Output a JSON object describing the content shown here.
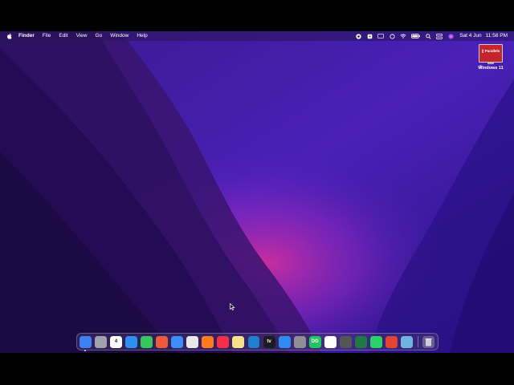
{
  "menubar": {
    "items": [
      "Finder",
      "File",
      "Edit",
      "View",
      "Go",
      "Window",
      "Help"
    ],
    "date": "Sat 4 Jun",
    "time": "11:58 PM",
    "status_icons": [
      "screen-record-icon",
      "notes-icon",
      "keyboard-icon",
      "sync-icon",
      "wifi-icon",
      "battery-icon",
      "search-icon",
      "control-center-icon",
      "siri-icon"
    ]
  },
  "desktop": {
    "icon_label": "Windows 11",
    "icon_brand": "|| Parallels",
    "icon_sub": "2"
  },
  "dock": {
    "apps": [
      {
        "name": "finder",
        "color": "#3b82f6"
      },
      {
        "name": "launchpad",
        "color": "#9ca3af"
      },
      {
        "name": "calendar",
        "color": "#ffffff",
        "text": "4"
      },
      {
        "name": "safari",
        "color": "#2f8ff0"
      },
      {
        "name": "messages",
        "color": "#34c759"
      },
      {
        "name": "pixelmator",
        "color": "#f05a3a"
      },
      {
        "name": "mail",
        "color": "#3a8ef6"
      },
      {
        "name": "chrome",
        "color": "#e8e8e8"
      },
      {
        "name": "firefox",
        "color": "#ff7a1a"
      },
      {
        "name": "music",
        "color": "#fa2d48"
      },
      {
        "name": "notes",
        "color": "#f7e08a"
      },
      {
        "name": "vscode",
        "color": "#1f7fd1"
      },
      {
        "name": "apple-tv",
        "color": "#1c1c1e",
        "text": "tv"
      },
      {
        "name": "app-store",
        "color": "#2d8cf0"
      },
      {
        "name": "system-preferences",
        "color": "#8e8e93"
      },
      {
        "name": "datagrip",
        "color": "#22c55e",
        "text": "DG"
      },
      {
        "name": "slack",
        "color": "#ffffff"
      },
      {
        "name": "calculator",
        "color": "#555555"
      },
      {
        "name": "excel",
        "color": "#1d7a45"
      },
      {
        "name": "whatsapp",
        "color": "#25d366"
      },
      {
        "name": "todoist",
        "color": "#e44332"
      },
      {
        "name": "preview",
        "color": "#6fb3e0"
      }
    ],
    "trash": "trash"
  }
}
